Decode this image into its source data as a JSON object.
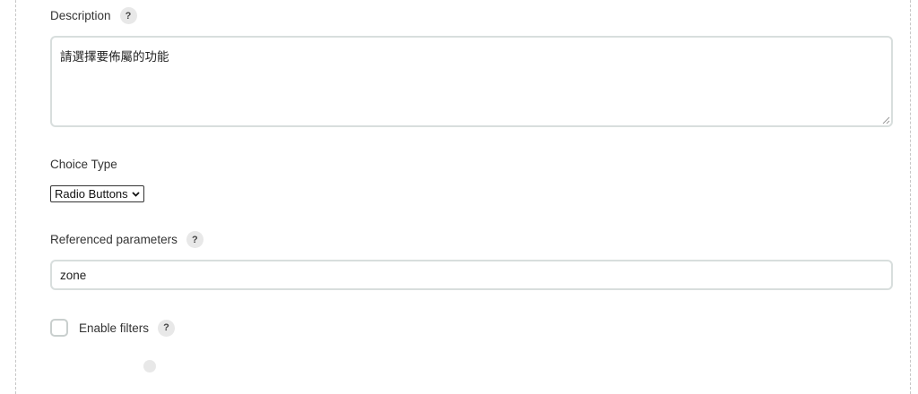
{
  "description": {
    "label": "Description",
    "help": "?",
    "value": "請選擇要佈屬的功能"
  },
  "choice_type": {
    "label": "Choice Type",
    "selected": "Radio Buttons"
  },
  "referenced_parameters": {
    "label": "Referenced parameters",
    "help": "?",
    "value": "zone"
  },
  "enable_filters": {
    "label": "Enable filters",
    "help": "?",
    "checked": false
  }
}
